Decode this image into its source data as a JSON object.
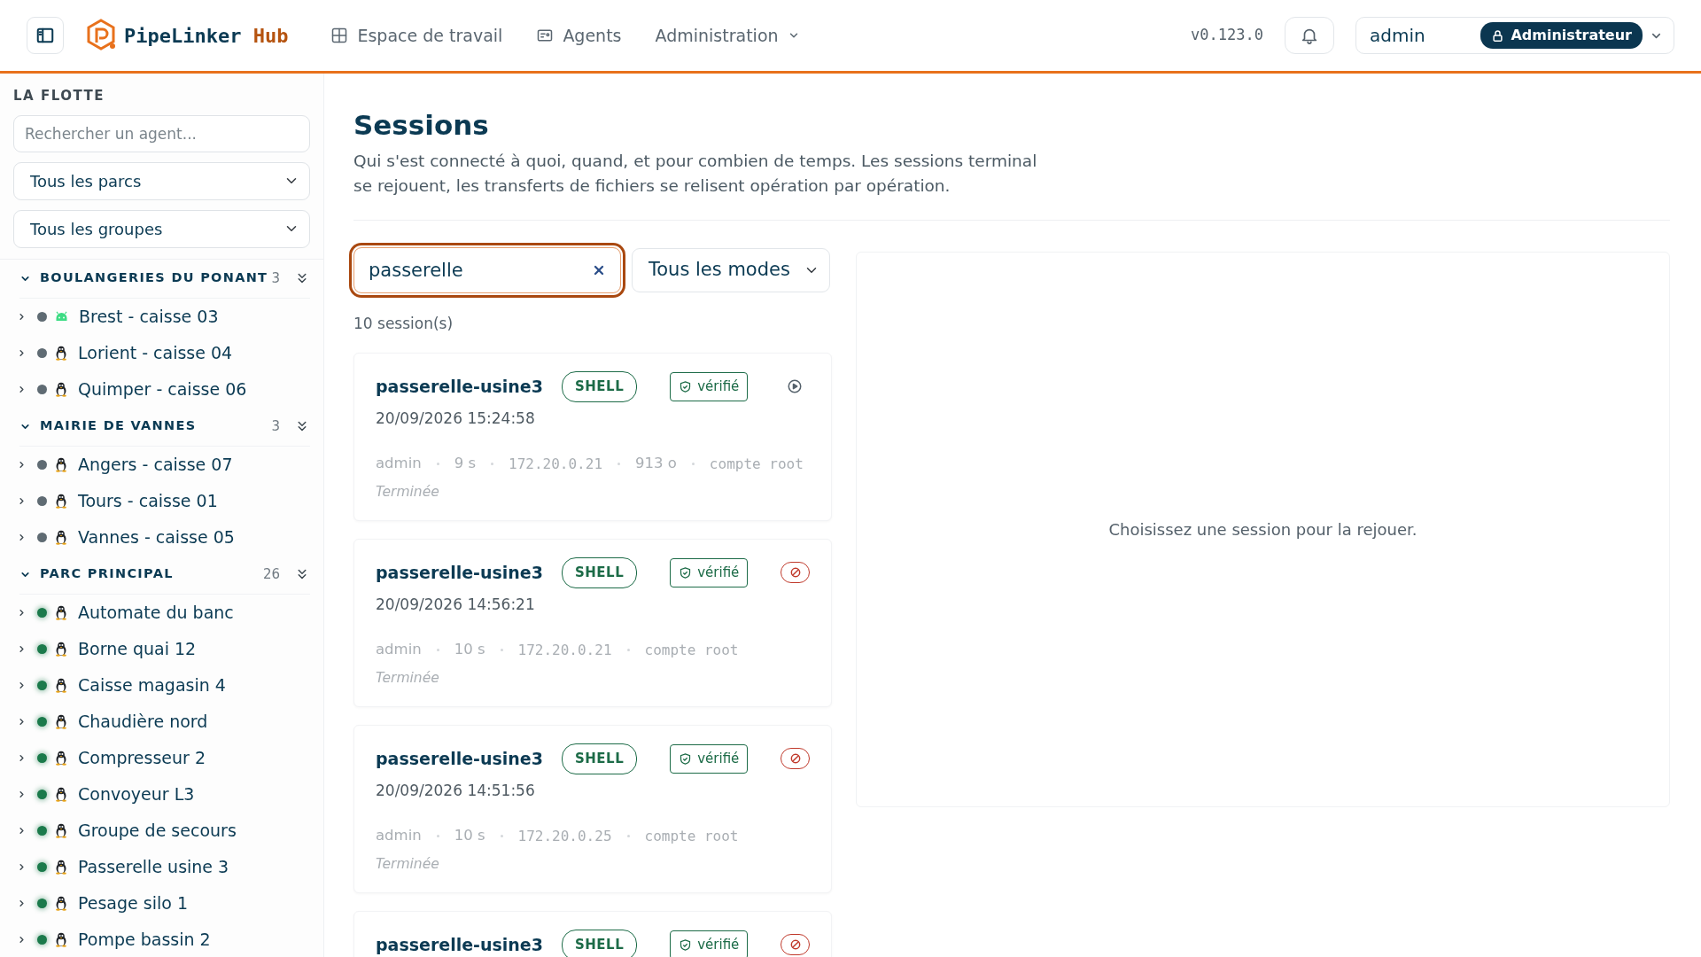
{
  "header": {
    "brand": {
      "name": "PipeLinker",
      "suffix": "Hub"
    },
    "nav": [
      {
        "label": "Espace de travail",
        "kind": "workspace"
      },
      {
        "label": "Agents",
        "kind": "agents"
      },
      {
        "label": "Administration",
        "kind": "dropdown"
      }
    ],
    "version": "v0.123.0",
    "user": {
      "name": "admin",
      "role": "Administrateur"
    }
  },
  "sidebar": {
    "title": "LA FLOTTE",
    "search": {
      "placeholder": "Rechercher un agent..."
    },
    "filters": [
      {
        "value": "Tous les parcs"
      },
      {
        "value": "Tous les groupes"
      }
    ],
    "groups": [
      {
        "name": "BOULANGERIES DU PONANT",
        "count": "3",
        "expanded": true,
        "agents": [
          {
            "name": "Brest - caisse 03",
            "online": false,
            "kind": "android",
            "expanded": false
          },
          {
            "name": "Lorient - caisse 04",
            "online": false,
            "kind": "linux",
            "expanded": false
          },
          {
            "name": "Quimper - caisse 06",
            "online": false,
            "kind": "linux",
            "expanded": false
          }
        ]
      },
      {
        "name": "MAIRIE DE VANNES",
        "count": "3",
        "expanded": true,
        "agents": [
          {
            "name": "Angers - caisse 07",
            "online": false,
            "kind": "linux",
            "expanded": false
          },
          {
            "name": "Tours - caisse 01",
            "online": false,
            "kind": "linux",
            "expanded": false
          },
          {
            "name": "Vannes - caisse 05",
            "online": false,
            "kind": "linux",
            "expanded": false
          }
        ]
      },
      {
        "name": "PARC PRINCIPAL",
        "count": "26",
        "expanded": true,
        "agents": [
          {
            "name": "Automate du banc",
            "online": true,
            "kind": "linux",
            "expanded": false
          },
          {
            "name": "Borne quai 12",
            "online": true,
            "kind": "linux",
            "expanded": false
          },
          {
            "name": "Caisse magasin 4",
            "online": true,
            "kind": "linux",
            "expanded": false
          },
          {
            "name": "Chaudière nord",
            "online": true,
            "kind": "linux",
            "expanded": false
          },
          {
            "name": "Compresseur 2",
            "online": true,
            "kind": "linux",
            "expanded": false
          },
          {
            "name": "Convoyeur L3",
            "online": true,
            "kind": "linux",
            "expanded": false
          },
          {
            "name": "Groupe de secours",
            "online": true,
            "kind": "linux",
            "expanded": false
          },
          {
            "name": "Passerelle usine 3",
            "online": true,
            "kind": "linux",
            "expanded": false
          },
          {
            "name": "Pesage silo 1",
            "online": true,
            "kind": "linux",
            "expanded": false
          },
          {
            "name": "Pompe bassin 2",
            "online": true,
            "kind": "linux",
            "expanded": false
          }
        ]
      }
    ]
  },
  "main": {
    "title": "Sessions",
    "description": "Qui s'est connecté à quoi, quand, et pour combien de temps. Les sessions terminal se rejouent, les transferts de fichiers se relisent opération par opération.",
    "search": {
      "value": "passerelle",
      "focused": true
    },
    "mode_filter": {
      "value": "Tous les modes"
    },
    "count": "10 session(s)",
    "sessions": [
      {
        "name": "passerelle-usine3",
        "mode": "SHELL",
        "verification": "vérifié",
        "replayable": true,
        "date": "20/09/2026 15:24:58",
        "meta": [
          {
            "text": "admin",
            "kind": "user"
          },
          {
            "text": "9 s",
            "kind": "duration"
          },
          {
            "text": "172.20.0.21",
            "kind": "ip"
          },
          {
            "text": "913 o",
            "kind": "size"
          },
          {
            "text": "compte root",
            "kind": "account"
          }
        ],
        "status": "Terminée"
      },
      {
        "name": "passerelle-usine3",
        "mode": "SHELL",
        "verification": "vérifié",
        "replayable": false,
        "date": "20/09/2026 14:56:21",
        "meta": [
          {
            "text": "admin",
            "kind": "user"
          },
          {
            "text": "10 s",
            "kind": "duration"
          },
          {
            "text": "172.20.0.21",
            "kind": "ip"
          },
          {
            "text": "compte root",
            "kind": "account"
          }
        ],
        "status": "Terminée"
      },
      {
        "name": "passerelle-usine3",
        "mode": "SHELL",
        "verification": "vérifié",
        "replayable": false,
        "date": "20/09/2026 14:51:56",
        "meta": [
          {
            "text": "admin",
            "kind": "user"
          },
          {
            "text": "10 s",
            "kind": "duration"
          },
          {
            "text": "172.20.0.25",
            "kind": "ip"
          },
          {
            "text": "compte root",
            "kind": "account"
          }
        ],
        "status": "Terminée"
      },
      {
        "name": "passerelle-usine3",
        "mode": "SHELL",
        "verification": "vérifié",
        "replayable": false
      }
    ],
    "viewer": {
      "empty_text": "Choisissez une session pour la rejouer."
    }
  }
}
